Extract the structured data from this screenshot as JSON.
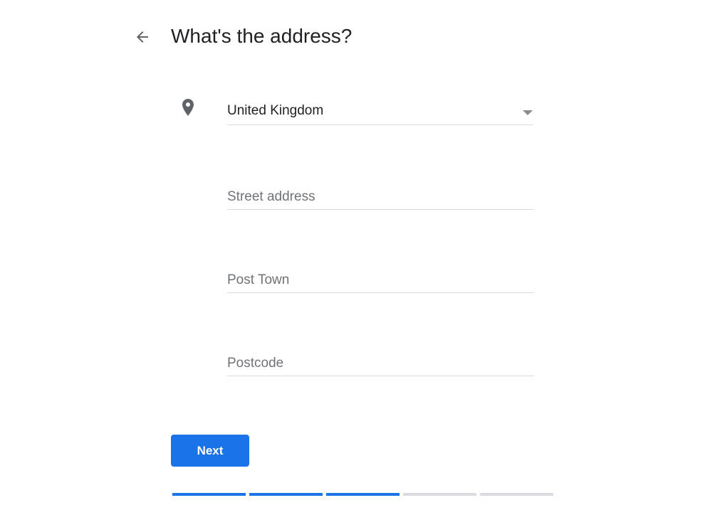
{
  "header": {
    "title": "What's the address?",
    "back_icon": "arrow-back-icon"
  },
  "form": {
    "location_icon": "location-pin-icon",
    "country": {
      "value": "United Kingdom",
      "icon": "dropdown-arrow-icon"
    },
    "street": {
      "placeholder": "Street address",
      "value": ""
    },
    "town": {
      "placeholder": "Post Town",
      "value": ""
    },
    "postcode": {
      "placeholder": "Postcode",
      "value": ""
    }
  },
  "actions": {
    "next_label": "Next"
  },
  "progress": {
    "total_steps": 5,
    "completed_steps": 3
  },
  "colors": {
    "accent": "#1a73e8",
    "track": "#dadce0"
  }
}
